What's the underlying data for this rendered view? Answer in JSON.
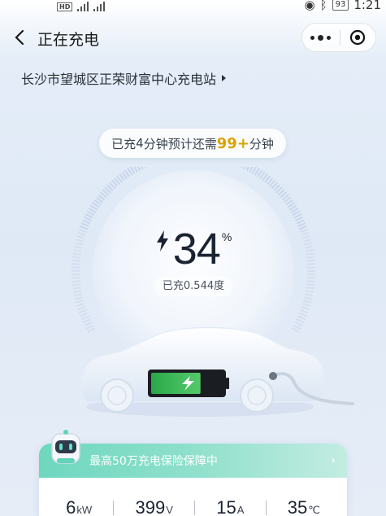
{
  "status_bar": {
    "battery": "93",
    "time": "1:21",
    "hd": "HD"
  },
  "header": {
    "title": "正在充电"
  },
  "station": {
    "name": "长沙市望城区正荣财富中心充电站"
  },
  "eta": {
    "prefix": "已充",
    "minutes_charged": "4",
    "middle": "分钟预计还需",
    "minutes_remaining": "99+",
    "suffix": "分钟"
  },
  "charge": {
    "percent": "34",
    "percent_sign": "%",
    "energy_text": "已充0.544度",
    "level_fraction": 0.34
  },
  "insurance": {
    "text": "最高50万充电保险保障中"
  },
  "stats": [
    {
      "value": "6",
      "unit": "kW"
    },
    {
      "value": "399",
      "unit": "V"
    },
    {
      "value": "15",
      "unit": "A"
    },
    {
      "value": "35",
      "unit": "℃"
    }
  ],
  "colors": {
    "accent_yellow": "#d9a400",
    "battery_green": "#39b54a",
    "card_green": "#6ed7be"
  }
}
